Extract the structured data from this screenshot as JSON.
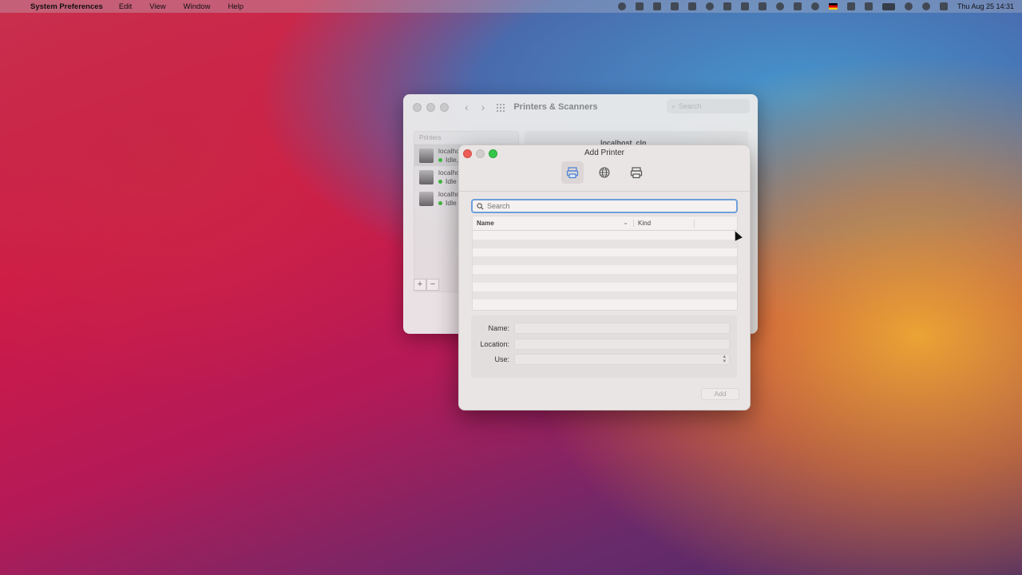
{
  "menubar": {
    "app_name": "System Preferences",
    "menus": [
      "Edit",
      "View",
      "Window",
      "Help"
    ],
    "datetime": "Thu Aug 25  14:31"
  },
  "back_window": {
    "title": "Printers & Scanners",
    "search_placeholder": "Search",
    "printers_header": "Printers",
    "printers": [
      {
        "name": "localhost",
        "status": "Idle,"
      },
      {
        "name": "localhost",
        "status": "Idle"
      },
      {
        "name": "localhost",
        "status": "Idle"
      }
    ],
    "detail_name": "localhost_cln"
  },
  "dialog": {
    "title": "Add Printer",
    "toolbar": [
      "default-printer-icon",
      "ip-globe-icon",
      "windows-printer-icon"
    ],
    "search_placeholder": "Search",
    "columns": {
      "name": "Name",
      "kind": "Kind"
    },
    "form": {
      "name_label": "Name:",
      "location_label": "Location:",
      "use_label": "Use:"
    },
    "add_label": "Add"
  }
}
